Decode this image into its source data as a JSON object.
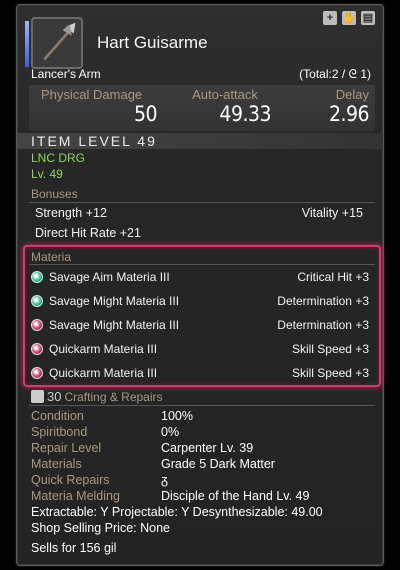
{
  "item": {
    "name": "Hart Guisarme",
    "category": "Lancer's Arm",
    "total": "(Total:2 / ",
    "total_end": " 1)"
  },
  "stats": [
    {
      "label": "Physical Damage",
      "value": "50"
    },
    {
      "label": "Auto-attack",
      "value": "49.33"
    },
    {
      "label": "Delay",
      "value": "2.96"
    }
  ],
  "item_level": "ITEM LEVEL 49",
  "classes": "LNC DRG",
  "level": "Lv. 49",
  "bonuses": {
    "title": "Bonuses",
    "rows": [
      {
        "left": "Strength +12",
        "right": "Vitality +15"
      },
      {
        "left": "Direct Hit Rate +21",
        "right": ""
      }
    ]
  },
  "materia": {
    "title": "Materia",
    "rows": [
      {
        "name": "Savage Aim Materia III",
        "effect": "Critical Hit +3",
        "orb_color": "#3fd0a8"
      },
      {
        "name": "Savage Might Materia III",
        "effect": "Determination +3",
        "orb_color": "#3fd0a8"
      },
      {
        "name": "Savage Might Materia III",
        "effect": "Determination +3",
        "orb_color": "#e04a7a"
      },
      {
        "name": "Quickarm Materia III",
        "effect": "Skill Speed +3",
        "orb_color": "#e04a7a"
      },
      {
        "name": "Quickarm Materia III",
        "effect": "Skill Speed +3",
        "orb_color": "#e04a7a"
      }
    ]
  },
  "crafting": {
    "num": "30",
    "title": "Crafting & Repairs",
    "rows": [
      {
        "k": "Condition",
        "v": "100%"
      },
      {
        "k": "Spiritbond",
        "v": "0%"
      },
      {
        "k": "Repair Level",
        "v": "Carpenter Lv. 39"
      },
      {
        "k": "Materials",
        "v": "Grade 5 Dark Matter"
      },
      {
        "k": "Quick Repairs",
        "v": "ᵹ"
      },
      {
        "k": "Materia Melding",
        "v": "Disciple of the Hand Lv. 49"
      }
    ],
    "extract_line": "Extractable: Y  Projectable: Y  Desynthesizable: 49.00",
    "shop_line": "Shop Selling Price: None",
    "sells": "Sells for 156 gil"
  },
  "colors": {
    "accent": "#e0336b",
    "label": "#a89a80",
    "green": "#8fd655"
  }
}
